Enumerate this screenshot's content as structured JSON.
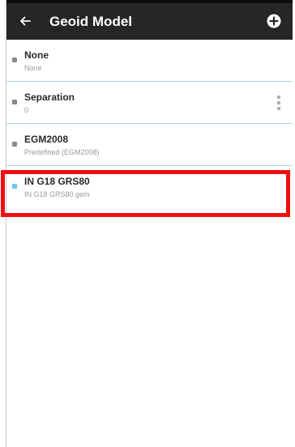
{
  "header": {
    "title": "Geoid Model",
    "back_icon": "arrow-left-icon",
    "add_icon": "plus-circle-icon"
  },
  "list": {
    "items": [
      {
        "name": "None",
        "subtitle": "None",
        "selected": false,
        "has_menu": false
      },
      {
        "name": "Separation",
        "subtitle": "0",
        "selected": false,
        "has_menu": true
      },
      {
        "name": "EGM2008",
        "subtitle": "Predefined (EGM2008)",
        "selected": false,
        "has_menu": false
      },
      {
        "name": "IN G18 GRS80",
        "subtitle": "IN G18 GRS80.gem",
        "selected": true,
        "has_menu": false
      }
    ]
  },
  "colors": {
    "app_bar": "#262626",
    "divider": "#a7d9ea",
    "bullet": "#8a8a8a",
    "bullet_selected": "#6cc6ea",
    "highlight": "#ee0e0e"
  }
}
